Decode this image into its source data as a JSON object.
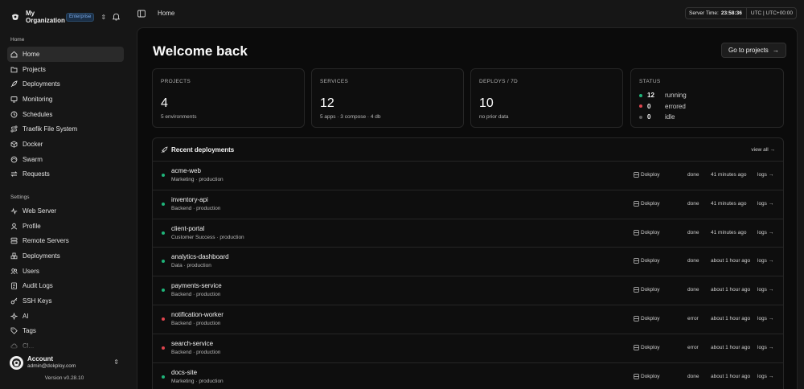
{
  "org": {
    "name": "My Organization",
    "plan_badge": "Enterprise"
  },
  "sidebar": {
    "home_section": "Home",
    "home_items": [
      {
        "label": "Home",
        "icon": "home-icon"
      },
      {
        "label": "Projects",
        "icon": "folder-icon"
      },
      {
        "label": "Deployments",
        "icon": "rocket-icon"
      },
      {
        "label": "Monitoring",
        "icon": "monitor-icon"
      },
      {
        "label": "Schedules",
        "icon": "clock-icon"
      },
      {
        "label": "Traefik File System",
        "icon": "route-icon"
      },
      {
        "label": "Docker",
        "icon": "box-icon"
      },
      {
        "label": "Swarm",
        "icon": "swarm-icon"
      },
      {
        "label": "Requests",
        "icon": "requests-icon"
      }
    ],
    "settings_section": "Settings",
    "settings_items": [
      {
        "label": "Web Server",
        "icon": "activity-icon"
      },
      {
        "label": "Profile",
        "icon": "user-icon"
      },
      {
        "label": "Remote Servers",
        "icon": "server-icon"
      },
      {
        "label": "Deployments",
        "icon": "boxes-icon"
      },
      {
        "label": "Users",
        "icon": "users-icon"
      },
      {
        "label": "Audit Logs",
        "icon": "log-icon"
      },
      {
        "label": "SSH Keys",
        "icon": "key-icon"
      },
      {
        "label": "AI",
        "icon": "sparkles-icon"
      },
      {
        "label": "Tags",
        "icon": "tag-icon"
      },
      {
        "label": "Cl...",
        "icon": "cloud-icon"
      }
    ],
    "account": {
      "title": "Account",
      "email": "admin@dokploy.com"
    },
    "version": "Version v0.28.10"
  },
  "topbar": {
    "breadcrumb": "Home",
    "server_time_label": "Server Time:",
    "server_time_value": "23:58:36",
    "timezone": "UTC | UTC+00:00"
  },
  "main": {
    "welcome": "Welcome back",
    "goto_label": "Go to projects",
    "cards": {
      "projects": {
        "label": "PROJECTS",
        "value": "4",
        "sub": "5 environments"
      },
      "services": {
        "label": "SERVICES",
        "value": "12",
        "sub": "5 apps · 3 compose · 4 db"
      },
      "deploys": {
        "label": "DEPLOYS / 7D",
        "value": "10",
        "sub": "no prior data"
      },
      "status": {
        "label": "STATUS",
        "rows": [
          {
            "count": "12",
            "name": "running",
            "color": "#1fb57a"
          },
          {
            "count": "0",
            "name": "errored",
            "color": "#e0454e"
          },
          {
            "count": "0",
            "name": "idle",
            "color": "#5e5e5e"
          }
        ]
      }
    },
    "recent": {
      "title": "Recent deployments",
      "view_all": "view all →",
      "rows": [
        {
          "name": "acme-web",
          "meta": "Marketing · production",
          "server": "Dokploy",
          "state": "done",
          "time": "41 minutes ago",
          "logs": "logs →",
          "color": "#1fb57a"
        },
        {
          "name": "inventory-api",
          "meta": "Backend · production",
          "server": "Dokploy",
          "state": "done",
          "time": "41 minutes ago",
          "logs": "logs →",
          "color": "#1fb57a"
        },
        {
          "name": "client-portal",
          "meta": "Customer Success · production",
          "server": "Dokploy",
          "state": "done",
          "time": "41 minutes ago",
          "logs": "logs →",
          "color": "#1fb57a"
        },
        {
          "name": "analytics-dashboard",
          "meta": "Data · production",
          "server": "Dokploy",
          "state": "done",
          "time": "about 1 hour ago",
          "logs": "logs →",
          "color": "#1fb57a"
        },
        {
          "name": "payments-service",
          "meta": "Backend · production",
          "server": "Dokploy",
          "state": "done",
          "time": "about 1 hour ago",
          "logs": "logs →",
          "color": "#1fb57a"
        },
        {
          "name": "notification-worker",
          "meta": "Backend · production",
          "server": "Dokploy",
          "state": "error",
          "time": "about 1 hour ago",
          "logs": "logs →",
          "color": "#e0454e"
        },
        {
          "name": "search-service",
          "meta": "Backend · production",
          "server": "Dokploy",
          "state": "error",
          "time": "about 1 hour ago",
          "logs": "logs →",
          "color": "#e0454e"
        },
        {
          "name": "docs-site",
          "meta": "Marketing · production",
          "server": "Dokploy",
          "state": "done",
          "time": "about 1 hour ago",
          "logs": "logs →",
          "color": "#1fb57a"
        }
      ]
    }
  }
}
